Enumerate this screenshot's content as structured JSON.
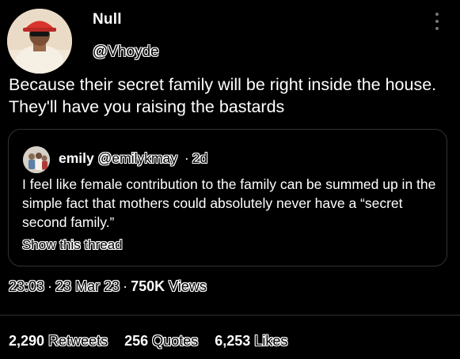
{
  "tweet": {
    "author": {
      "name": "Null",
      "handle": "@Vhoyde",
      "avatar": "avatar-person-red-cap"
    },
    "more_icon": "more-vertical-icon",
    "text": "Because their secret family will be right inside the house. They'll have you raising the bastards",
    "quote": {
      "avatar": "avatar-small-group",
      "name": "emily",
      "handle": "@emilykmay",
      "separator": "·",
      "time": "2d",
      "text": "I feel like female contribution to the family can be summed up in the simple fact that mothers could absolutely never have a “secret second family.”",
      "show_thread_label": "Show this thread"
    },
    "meta": {
      "time": "23:03",
      "separator": "·",
      "date": "23 Mar 23",
      "views_count": "750K",
      "views_label": "Views"
    },
    "stats": {
      "retweets_count": "2,290",
      "retweets_label": "Retweets",
      "quotes_count": "256",
      "quotes_label": "Quotes",
      "likes_count": "6,253",
      "likes_label": "Likes"
    }
  },
  "colors": {
    "background": "#000000",
    "text": "#ffffff",
    "border": "#2f3336"
  }
}
